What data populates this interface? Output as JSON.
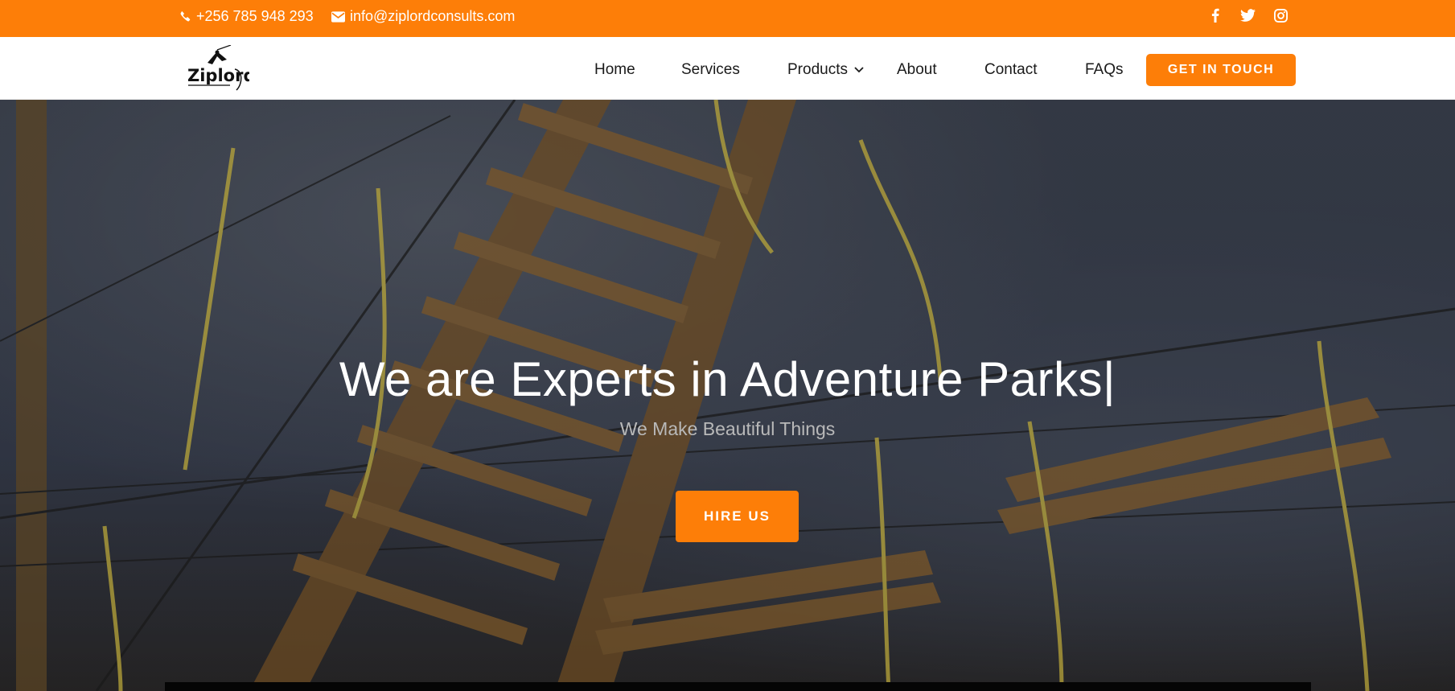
{
  "topbar": {
    "phone": "+256 785 948 293",
    "email": "info@ziplordconsults.com",
    "social": [
      "facebook-icon",
      "twitter-icon",
      "instagram-icon"
    ],
    "bg_color": "#fd7e08"
  },
  "logo": {
    "text": "Ziplord"
  },
  "nav": {
    "items": [
      {
        "label": "Home"
      },
      {
        "label": "Services"
      },
      {
        "label": "Products"
      },
      {
        "label": "About"
      },
      {
        "label": "Contact"
      },
      {
        "label": "FAQs"
      }
    ],
    "cta_label": "GET IN TOUCH"
  },
  "hero": {
    "title": "We are Experts in Adventure Parks|",
    "subtitle": "We Make Beautiful Things",
    "button_label": "HIRE US"
  },
  "colors": {
    "accent": "#fd7e08",
    "text": "#1a1a1a"
  }
}
